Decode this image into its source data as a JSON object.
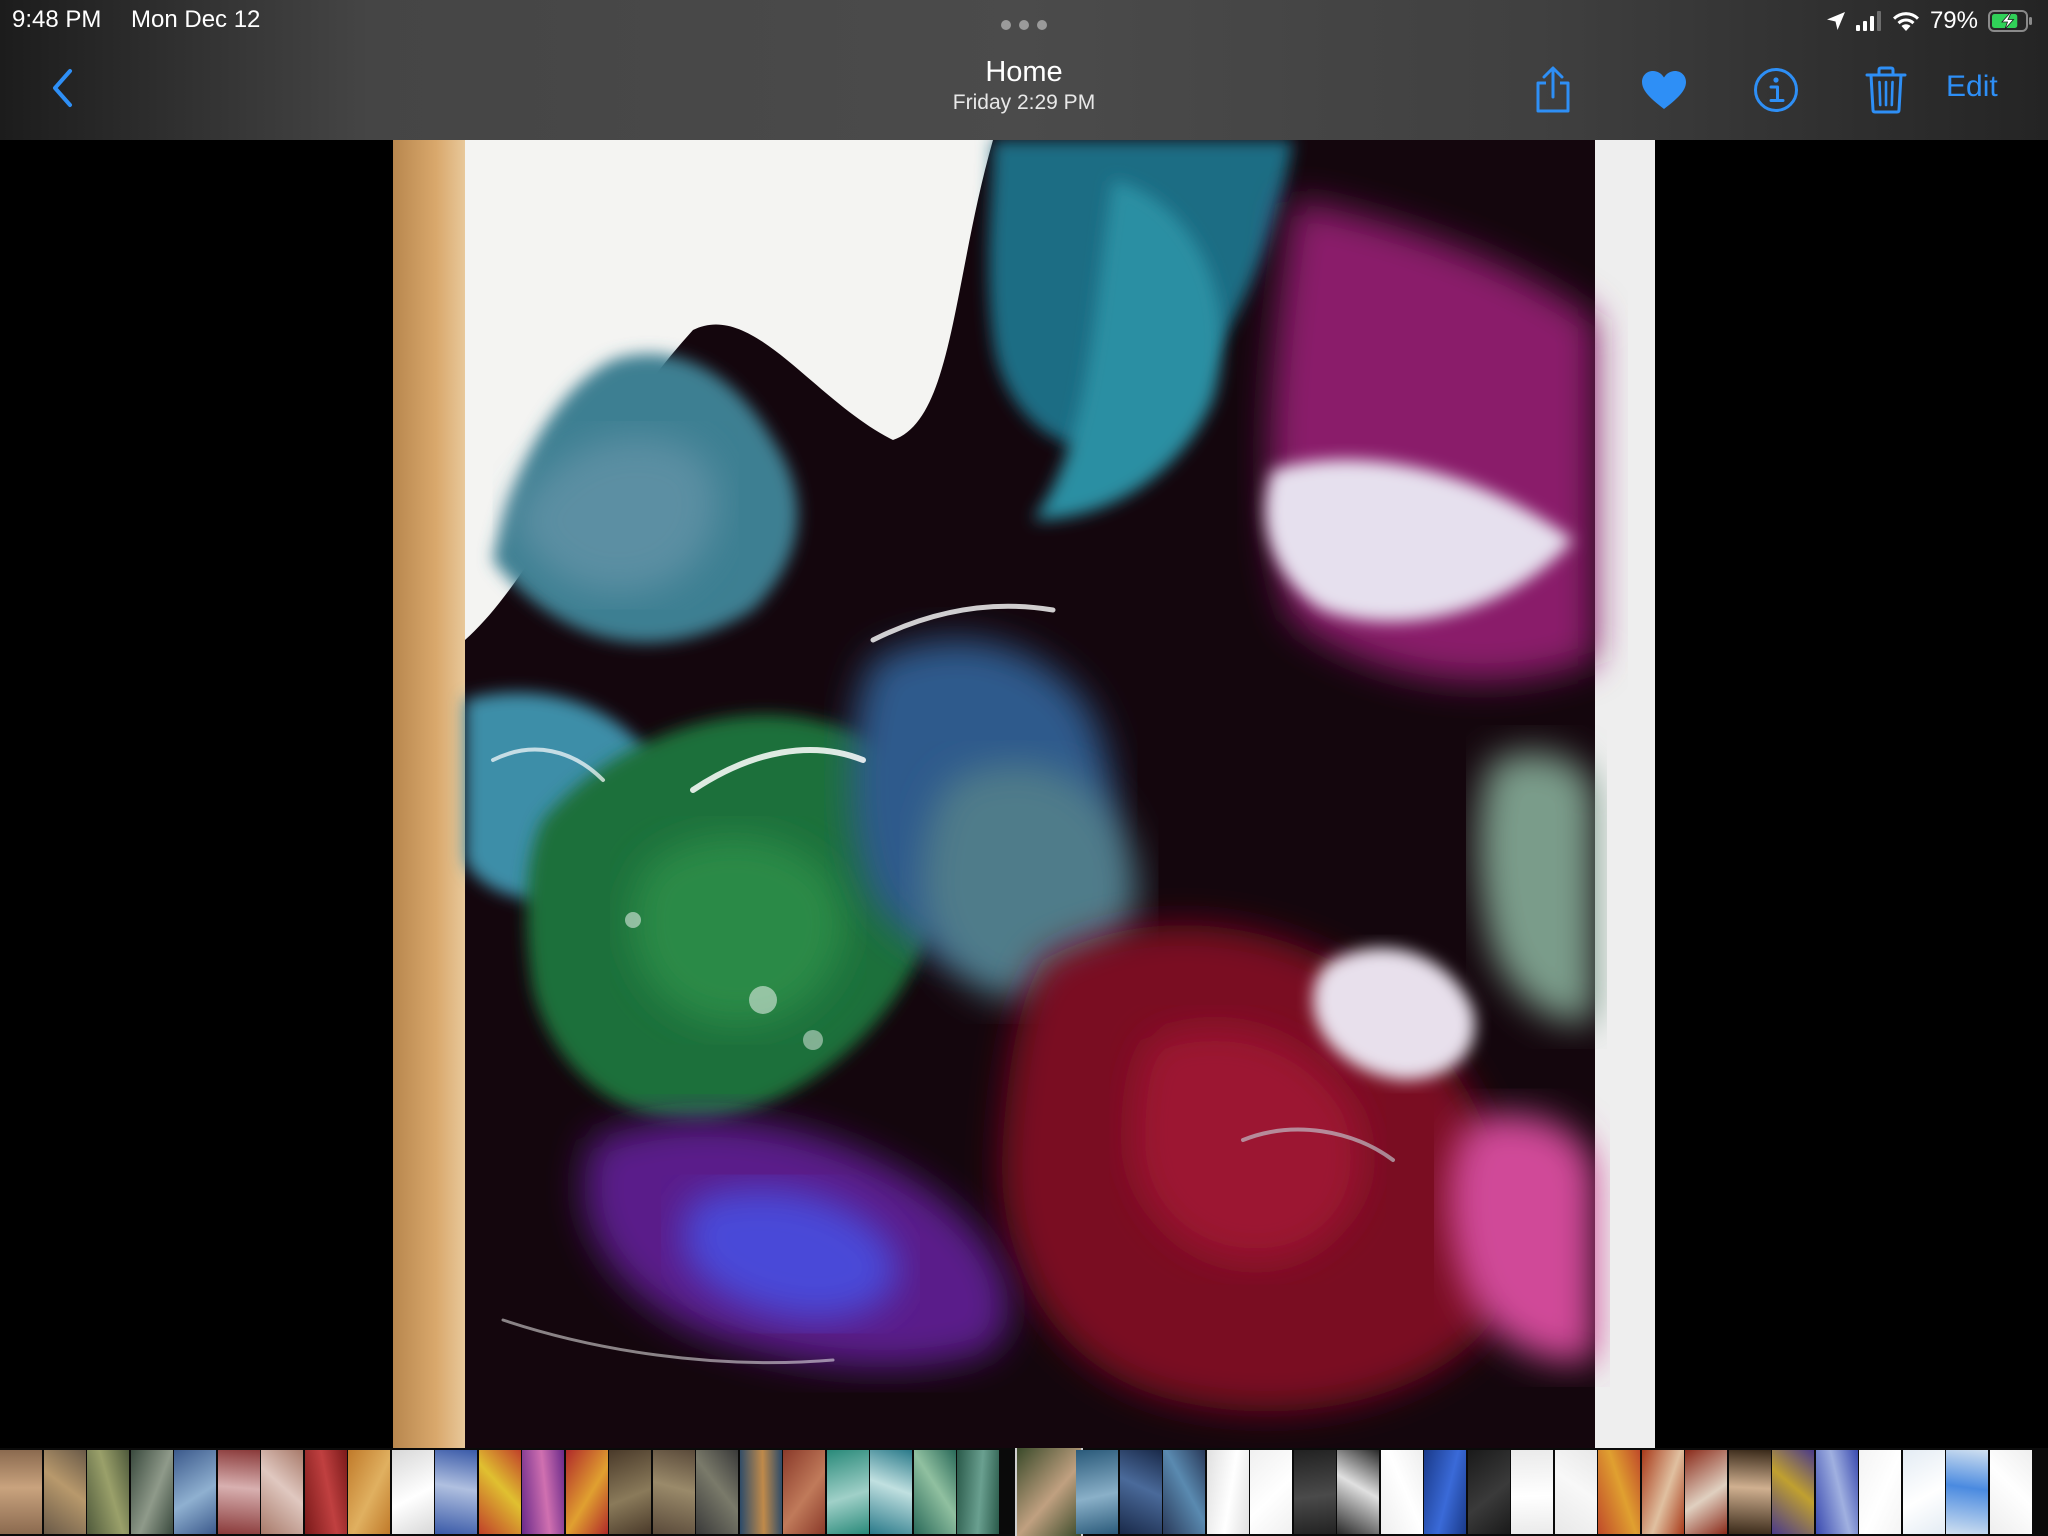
{
  "status_bar": {
    "time": "9:48 PM",
    "date": "Mon Dec 12",
    "battery": "79%",
    "battery_level": 0.79,
    "colors": {
      "battery": "#30d158",
      "text": "#ffffff"
    }
  },
  "nav": {
    "title": "Home",
    "subtitle": "Friday  2:29 PM",
    "edit_label": "Edit",
    "icons": [
      "chevron-left-icon",
      "share-icon",
      "heart-icon",
      "info-icon",
      "trash-icon"
    ],
    "favorited": true,
    "accent_color": "#2e8ff6"
  },
  "photo": {
    "description_icon": "abstract-painting"
  },
  "thumbnails": {
    "count": 46,
    "current_index": 23
  }
}
